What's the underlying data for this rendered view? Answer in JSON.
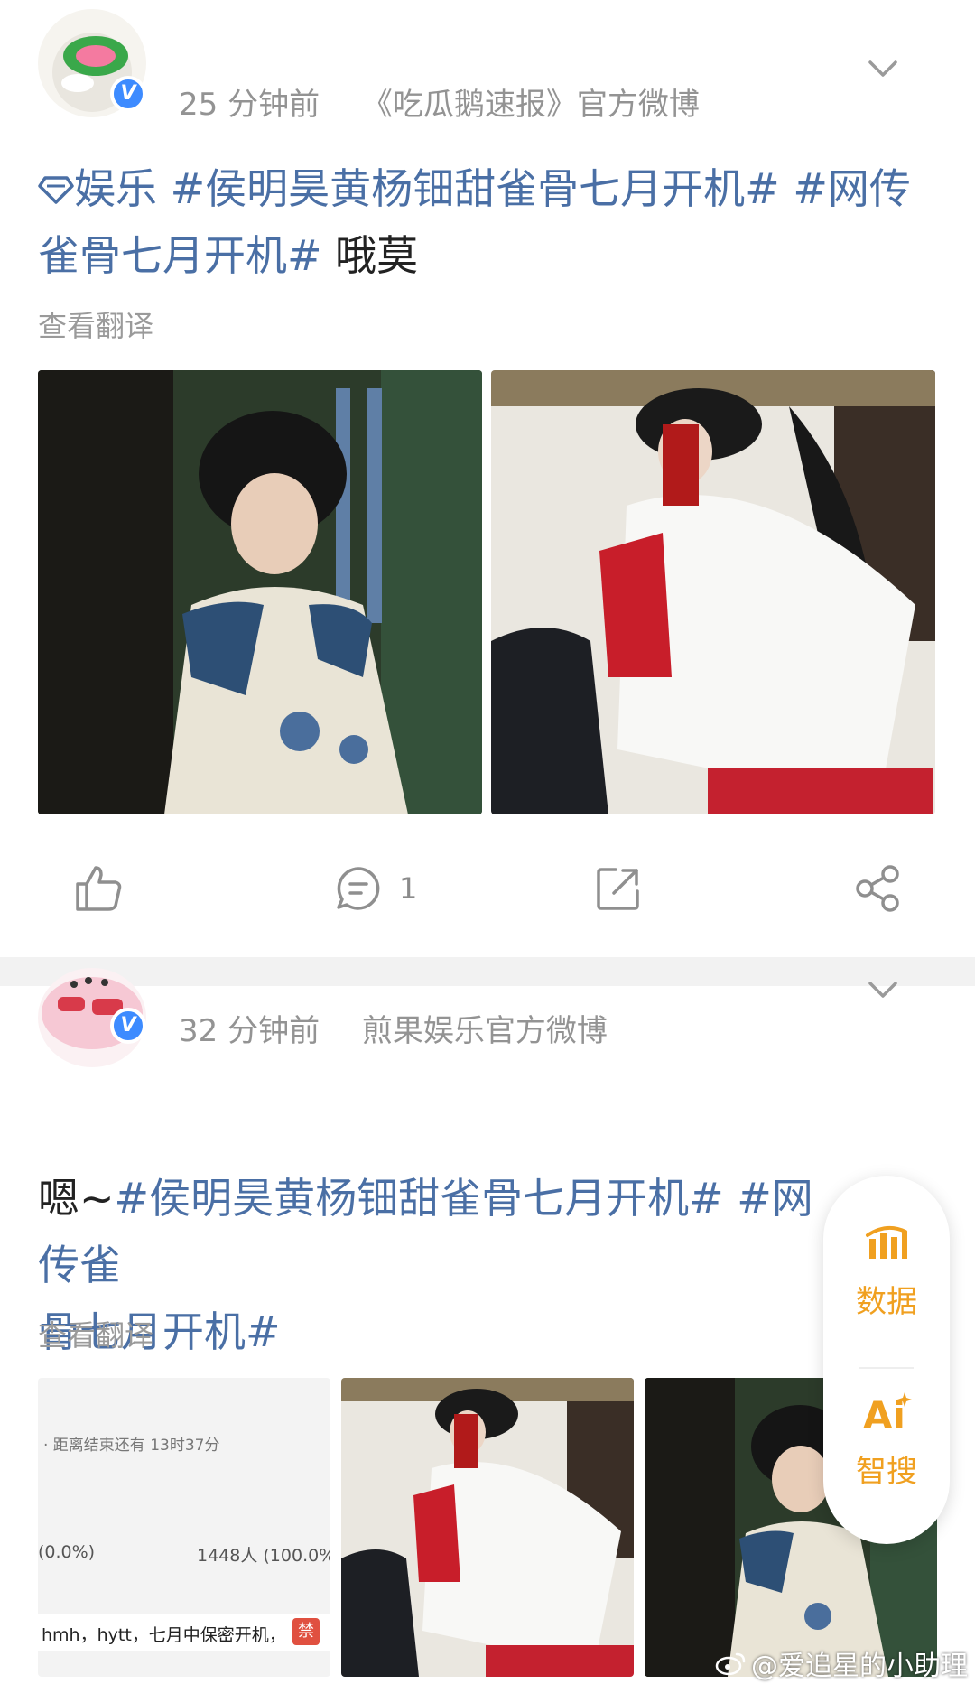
{
  "post1": {
    "time": "25 分钟前",
    "source": "《吃瓜鹅速报》官方微博",
    "category": "娱乐",
    "tag1": "#侯明昊黄杨钿甜雀骨七月开机#",
    "tag2_part1": "#网传",
    "tag2_part2": "雀骨七月开机#",
    "text_tail": "哦莫",
    "translate": "查看翻译",
    "comment_count": "1"
  },
  "post2": {
    "time": "32 分钟前",
    "source": "煎果娱乐官方微博",
    "text_head": "嗯~",
    "tag1": "#侯明昊黄杨钿甜雀骨七月开机#",
    "tag2_part1": "#网传雀",
    "tag2_part2": "骨七月开机#",
    "translate": "查看翻译",
    "screenshot": {
      "countdown": "· 距离结束还有 13时37分",
      "left_percent": "(0.0%)",
      "right_count": "1448人 (100.0%",
      "note": "hmh，hytt，七月中保密开机，",
      "ban": "禁"
    }
  },
  "fab": {
    "data_label": "数据",
    "search_label": "智搜"
  },
  "watermark": "@爱追星的小助理",
  "colors": {
    "link": "#4a6fa5",
    "meta": "#939393",
    "accent": "#f0a020",
    "verified": "#3d8bff"
  }
}
